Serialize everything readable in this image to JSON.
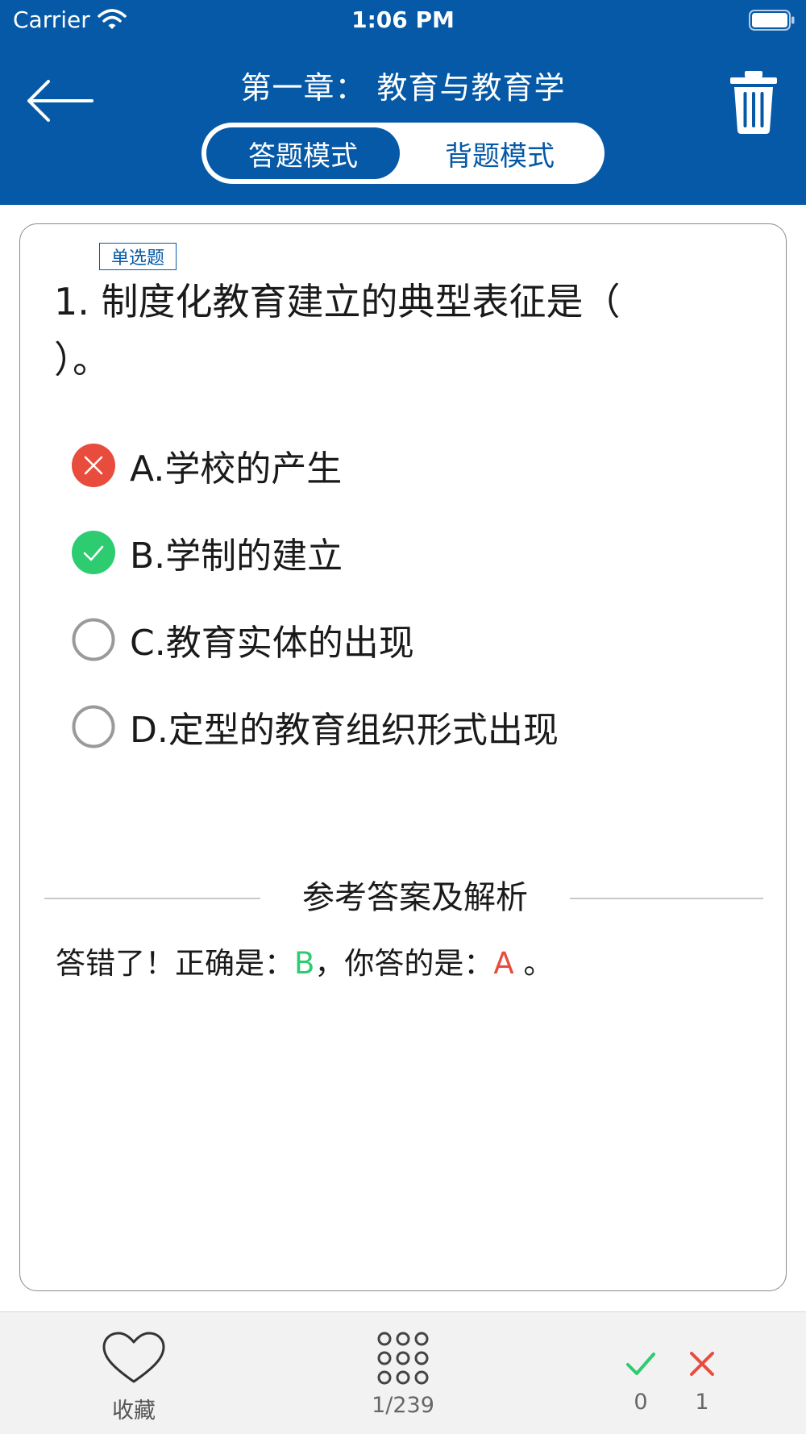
{
  "status_bar": {
    "carrier": "Carrier",
    "time": "1:06 PM"
  },
  "header": {
    "title": "第一章：  教育与教育学",
    "modes": [
      {
        "label": "答题模式",
        "active": true
      },
      {
        "label": "背题模式",
        "active": false
      }
    ]
  },
  "question": {
    "type_label": "单选题",
    "text": "1. 制度化教育建立的典型表征是（  ）。",
    "options": [
      {
        "label": "A.学校的产生",
        "state": "wrong"
      },
      {
        "label": "B.学制的建立",
        "state": "correct"
      },
      {
        "label": "C.教育实体的出现",
        "state": "none"
      },
      {
        "label": "D.定型的教育组织形式出现",
        "state": "none"
      }
    ]
  },
  "analysis": {
    "title": "参考答案及解析",
    "prefix": "答错了！正确是：",
    "correct": "B",
    "middle": "，你答的是：",
    "yours": "A",
    "suffix": " 。"
  },
  "bottom_bar": {
    "favorite_label": "收藏",
    "page_counter": "1/239",
    "correct_count": "0",
    "wrong_count": "1"
  },
  "colors": {
    "brand": "#0559a6",
    "correct": "#2ecc71",
    "wrong": "#e74c3c"
  }
}
